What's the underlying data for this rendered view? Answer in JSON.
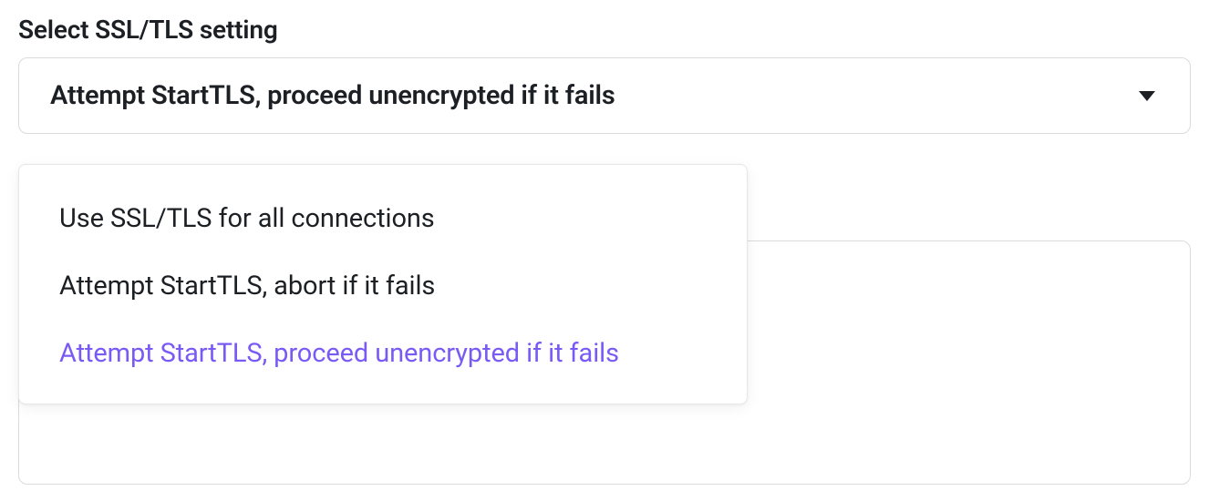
{
  "field": {
    "label": "Select SSL/TLS setting",
    "selected_value": "Attempt StartTLS, proceed unencrypted if it fails"
  },
  "dropdown": {
    "options": [
      {
        "label": "Use SSL/TLS for all connections",
        "selected": false
      },
      {
        "label": "Attempt StartTLS, abort if it fails",
        "selected": false
      },
      {
        "label": "Attempt StartTLS, proceed unencrypted if it fails",
        "selected": true
      }
    ]
  },
  "colors": {
    "text": "#1c2024",
    "border": "#d9dbde",
    "selected": "#7a5af5"
  }
}
